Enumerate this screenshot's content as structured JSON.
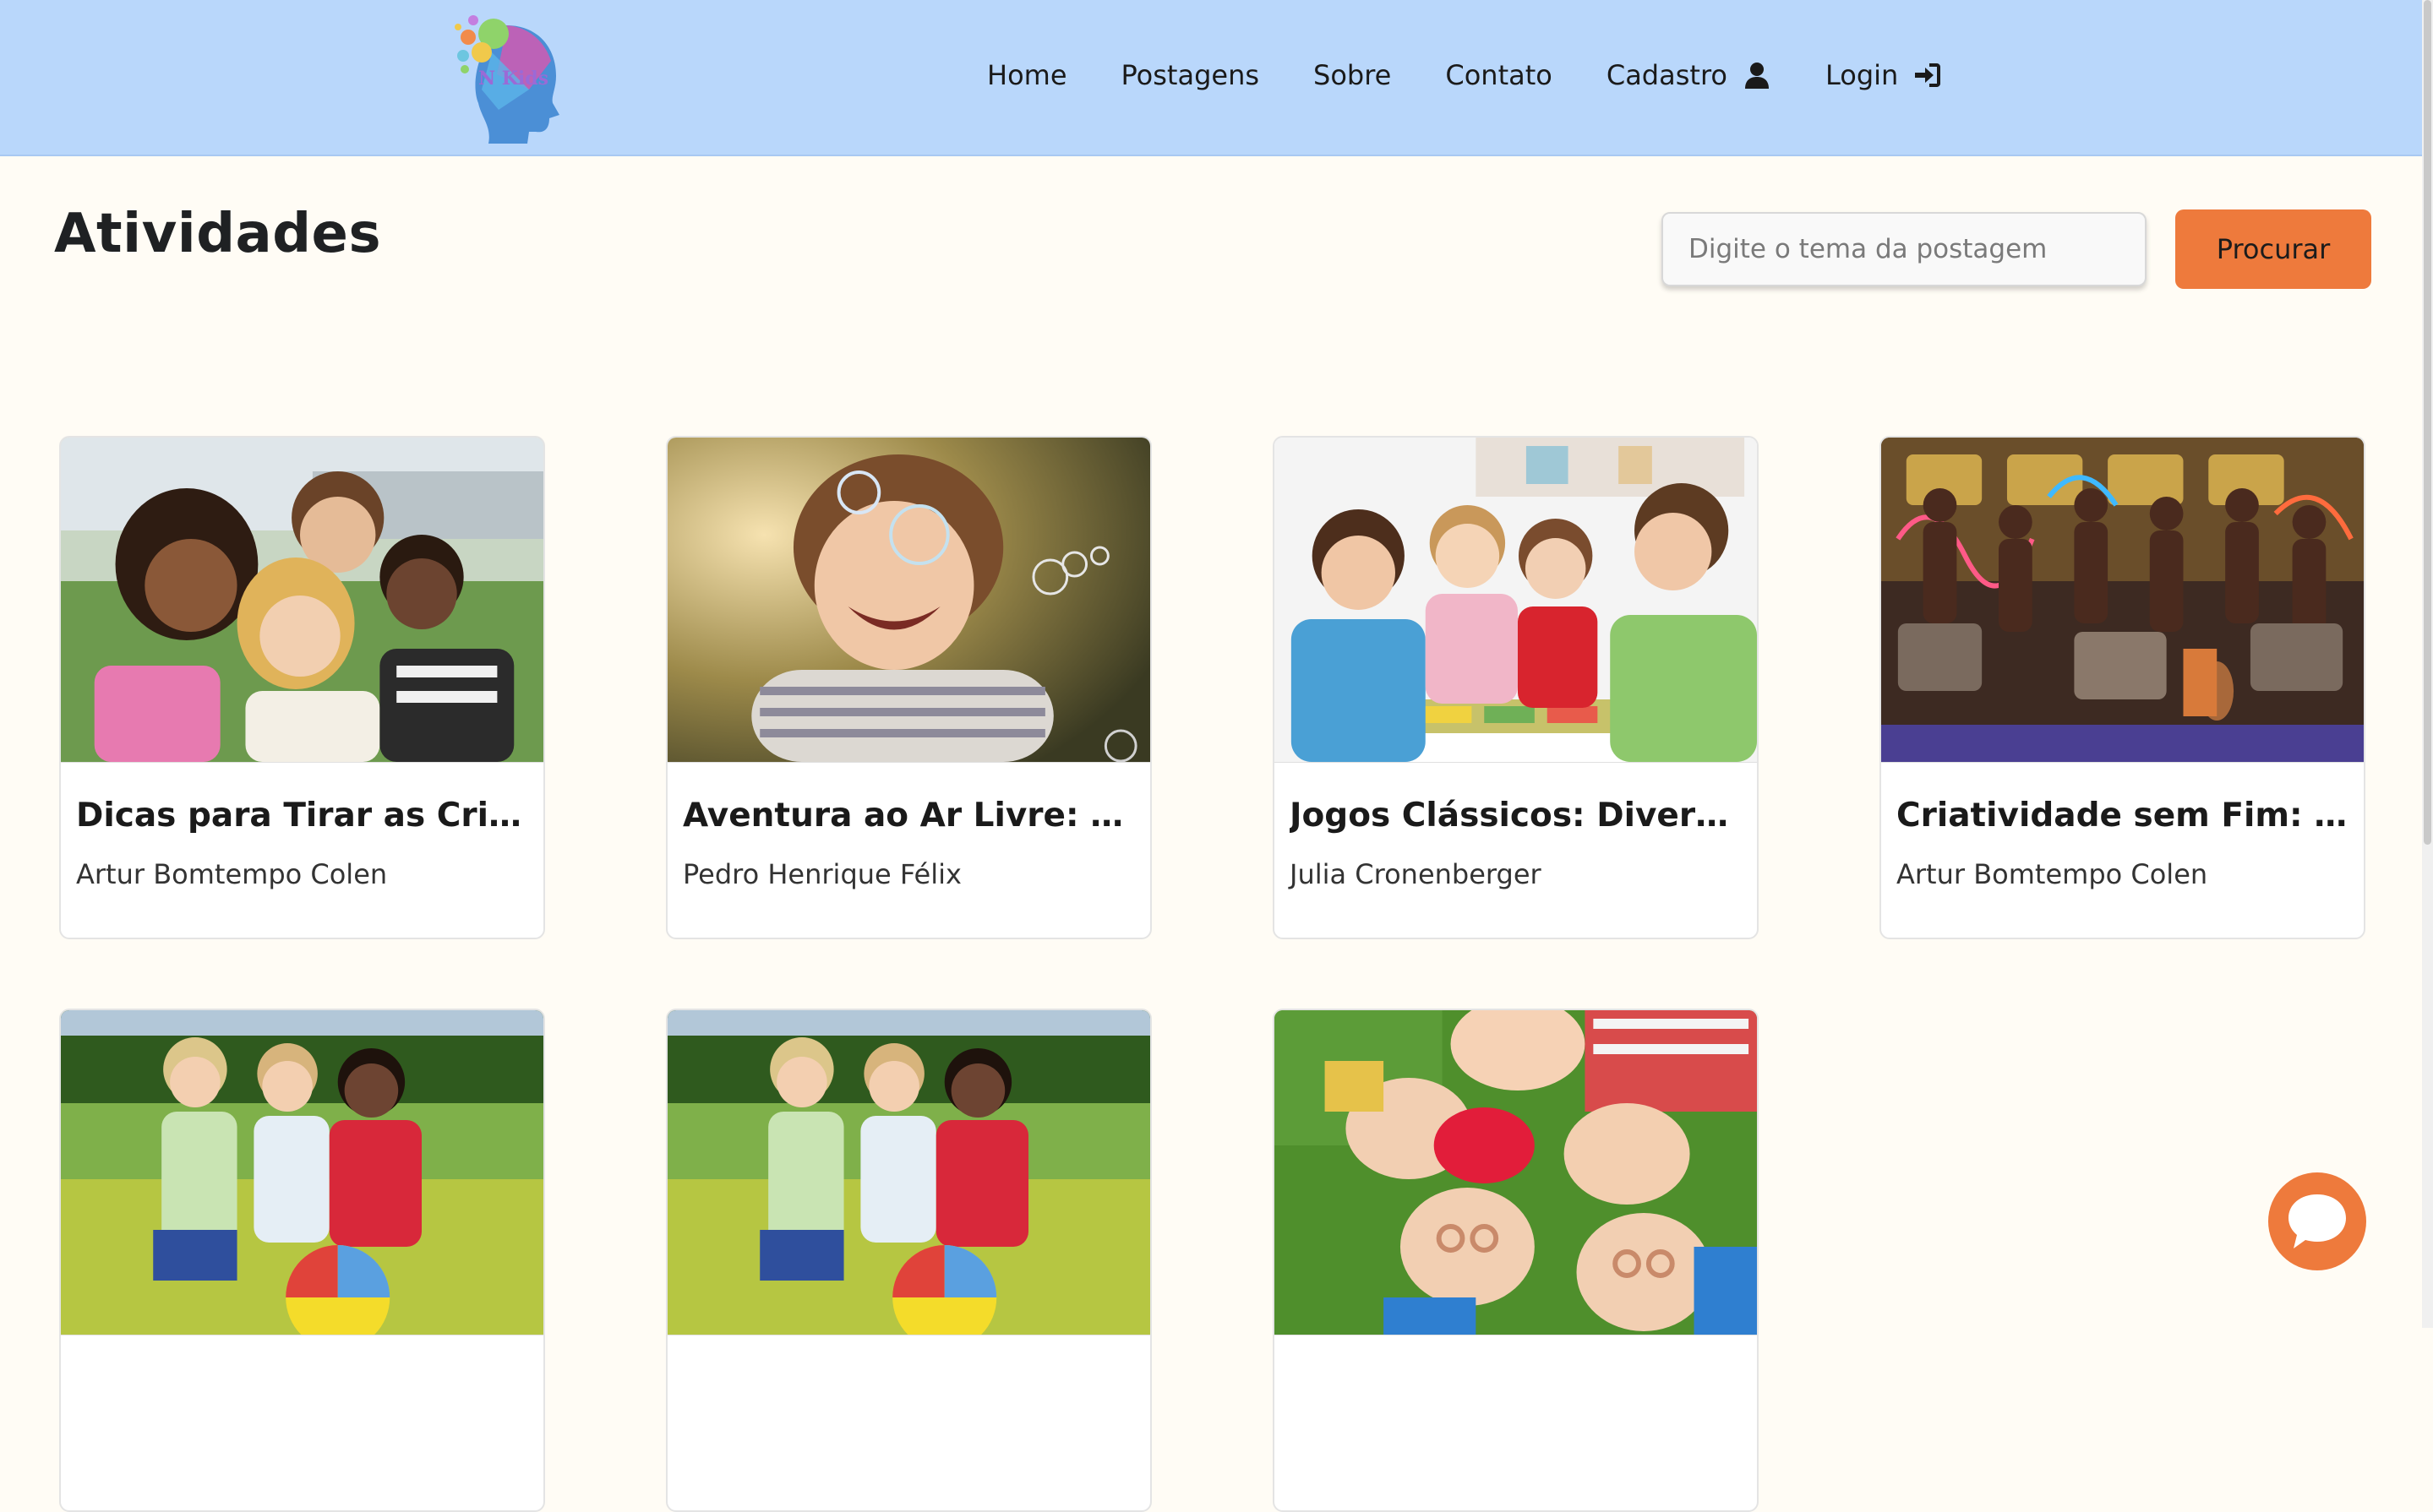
{
  "header": {
    "logo_text": "N Kids",
    "nav": [
      {
        "label": "Home",
        "icon": null
      },
      {
        "label": "Postagens",
        "icon": null
      },
      {
        "label": "Sobre",
        "icon": null
      },
      {
        "label": "Contato",
        "icon": null
      },
      {
        "label": "Cadastro",
        "icon": "user-icon"
      },
      {
        "label": "Login",
        "icon": "sign-in-icon"
      }
    ]
  },
  "page": {
    "title": "Atividades"
  },
  "search": {
    "placeholder": "Digite o tema da postagem",
    "value": "",
    "button_label": "Procurar"
  },
  "cards": [
    {
      "title": "Dicas para Tirar as Crian...",
      "author": "Artur Bomtempo Colen"
    },
    {
      "title": "Aventura ao Ar Livre: Expl...",
      "author": "Pedro Henrique Félix"
    },
    {
      "title": "Jogos Clássicos: Diversã...",
      "author": "Julia Cronenberger"
    },
    {
      "title": "Criatividade sem Fim: Ati...",
      "author": "Artur Bomtempo Colen"
    },
    {
      "title": "",
      "author": ""
    },
    {
      "title": "",
      "author": ""
    },
    {
      "title": "",
      "author": ""
    }
  ],
  "colors": {
    "header_bg": "#b9d7fb",
    "page_bg": "#fffcf5",
    "accent": "#ee7a3c"
  }
}
